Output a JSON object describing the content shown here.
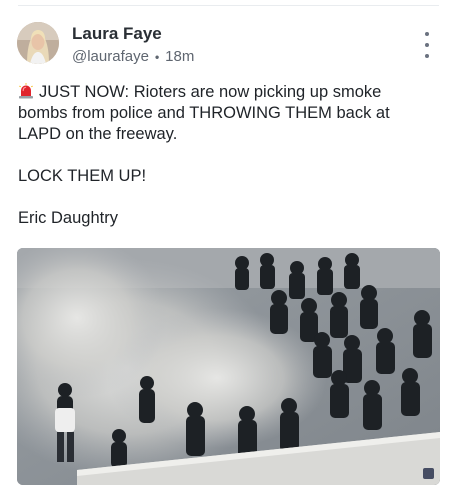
{
  "post": {
    "author_name": "Laura Faye",
    "handle": "@laurafaye",
    "separator": "•",
    "timestamp": "18m",
    "lines": [
      "JUST NOW: Rioters are now picking up smoke bombs from police and THROWING THEM back at LAPD on the freeway.",
      "LOCK THEM UP!",
      "Eric Daughtry"
    ],
    "icons": {
      "siren": "police-light-icon",
      "more": "vertical-dots-icon"
    }
  },
  "colors": {
    "accent_siren": "#e0242c",
    "text_primary": "#1f2328",
    "text_secondary": "#5f6670"
  }
}
